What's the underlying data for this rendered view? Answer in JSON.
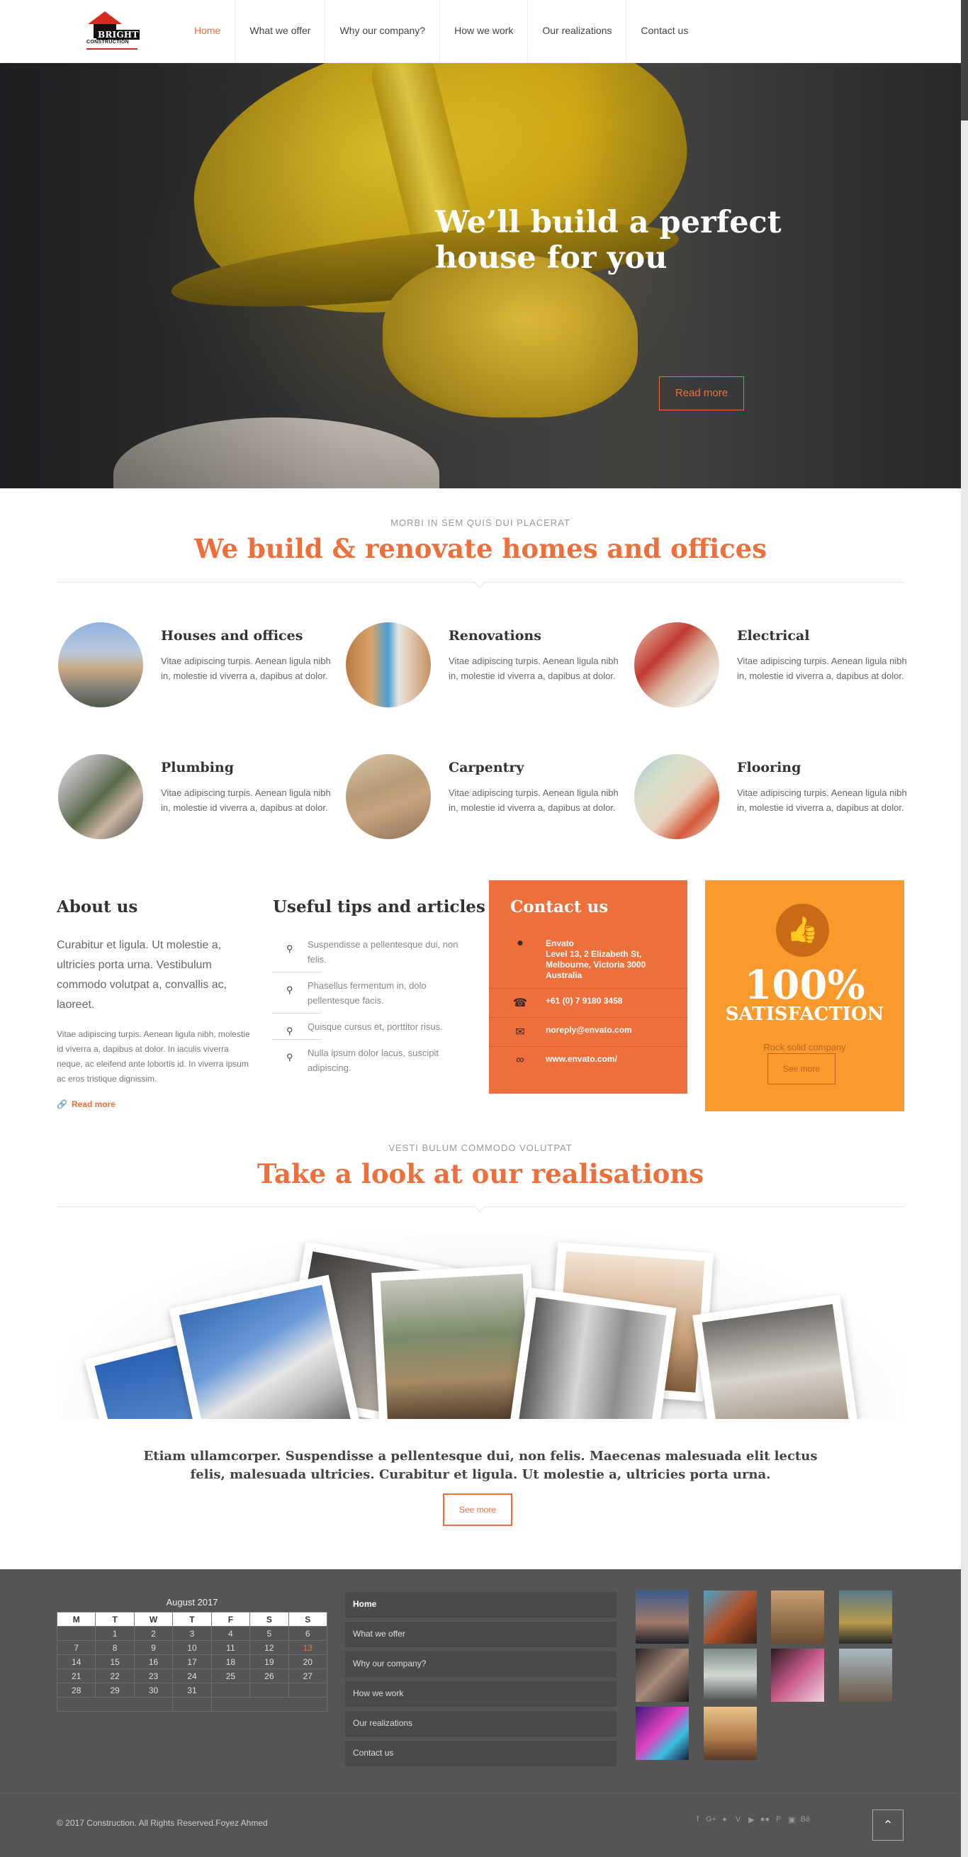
{
  "brand": {
    "word1": "BRIGHT",
    "word2": "CONSTRUCTION"
  },
  "nav": [
    "Home",
    "What we offer",
    "Why our company?",
    "How we work",
    "Our realizations",
    "Contact us"
  ],
  "hero": {
    "title": "We’ll build a perfect house for you",
    "button": "Read more"
  },
  "services_section": {
    "subtitle": "MORBI IN SEM QUIS DUI PLACERAT",
    "title": "We build & renovate homes and offices"
  },
  "services": [
    {
      "title": "Houses and offices",
      "text": "Vitae adipiscing turpis. Aenean ligula nibh in, molestie id viverra a, dapibus at dolor."
    },
    {
      "title": "Renovations",
      "text": "Vitae adipiscing turpis. Aenean ligula nibh in, molestie id viverra a, dapibus at dolor."
    },
    {
      "title": "Electrical",
      "text": "Vitae adipiscing turpis. Aenean ligula nibh in, molestie id viverra a, dapibus at dolor."
    },
    {
      "title": "Plumbing",
      "text": "Vitae adipiscing turpis. Aenean ligula nibh in, molestie id viverra a, dapibus at dolor."
    },
    {
      "title": "Carpentry",
      "text": "Vitae adipiscing turpis. Aenean ligula nibh in, molestie id viverra a, dapibus at dolor."
    },
    {
      "title": "Flooring",
      "text": "Vitae adipiscing turpis. Aenean ligula nibh in, molestie id viverra a, dapibus at dolor."
    }
  ],
  "about": {
    "title": "About us",
    "lead": "Curabitur et ligula. Ut molestie a, ultricies porta urna. Vestibulum commodo volutpat a, convallis ac, laoreet.",
    "text": "Vitae adipiscing turpis. Aenean ligula nibh, molestie id viverra a, dapibus at dolor. In iaculis viverra neque, ac eleifend ante lobortis id. In viverra ipsum ac eros tristique dignissim.",
    "link": "Read more"
  },
  "tips": {
    "title": "Useful tips and articles",
    "items": [
      "Suspendisse a pellentesque dui, non felis.",
      "Phasellus fermentum in, dolo pellentesque facis.",
      "Quisque cursus et, porttitor risus.",
      "Nulla ipsum dolor lacus, suscipit adipiscing."
    ]
  },
  "contact": {
    "title": "Contact us",
    "company": "Envato",
    "address": "Level 13, 2 Elizabeth St, Melbourne, Victoria 3000 Australia",
    "phone": "+61 (0) 7 9180 3458",
    "email": "noreply@envato.com",
    "web": "www.envato.com/"
  },
  "satisfaction": {
    "big": "100%",
    "label": "SATISFACTION",
    "sub": "Rock solid company",
    "button": "See more"
  },
  "realisations": {
    "subtitle": "VESTI BULUM COMMODO VOLUTPAT",
    "title": "Take a look at our realisations",
    "quote": "Etiam ullamcorper. Suspendisse a pellentesque dui, non felis. Maecenas malesuada elit lectus felis, malesuada ultricies. Curabitur et ligula. Ut molestie a, ultricies porta urna.",
    "button": "See more"
  },
  "calendar": {
    "caption": "August 2017",
    "days": [
      "M",
      "T",
      "W",
      "T",
      "F",
      "S",
      "S"
    ],
    "rows": [
      [
        "",
        "1",
        "2",
        "3",
        "4",
        "5",
        "6"
      ],
      [
        "7",
        "8",
        "9",
        "10",
        "11",
        "12",
        "13"
      ],
      [
        "14",
        "15",
        "16",
        "17",
        "18",
        "19",
        "20"
      ],
      [
        "21",
        "22",
        "23",
        "24",
        "25",
        "26",
        "27"
      ],
      [
        "28",
        "29",
        "30",
        "31",
        "",
        "",
        ""
      ]
    ],
    "today": "13"
  },
  "footer_menu": [
    "Home",
    "What we offer",
    "Why our company?",
    "How we work",
    "Our realizations",
    "Contact us"
  ],
  "copyright": "© 2017 Construction. All Rights Reserved.Foyez Ahmed",
  "social_icons": [
    "facebook-icon",
    "google-plus-icon",
    "twitter-icon",
    "vimeo-icon",
    "youtube-icon",
    "flickr-icon",
    "pinterest-icon",
    "instagram-icon",
    "behance-icon"
  ],
  "colors": {
    "accent": "#ec6f3c",
    "satisfaction_bg": "#fb9a2c",
    "footer_bg": "#555555"
  }
}
